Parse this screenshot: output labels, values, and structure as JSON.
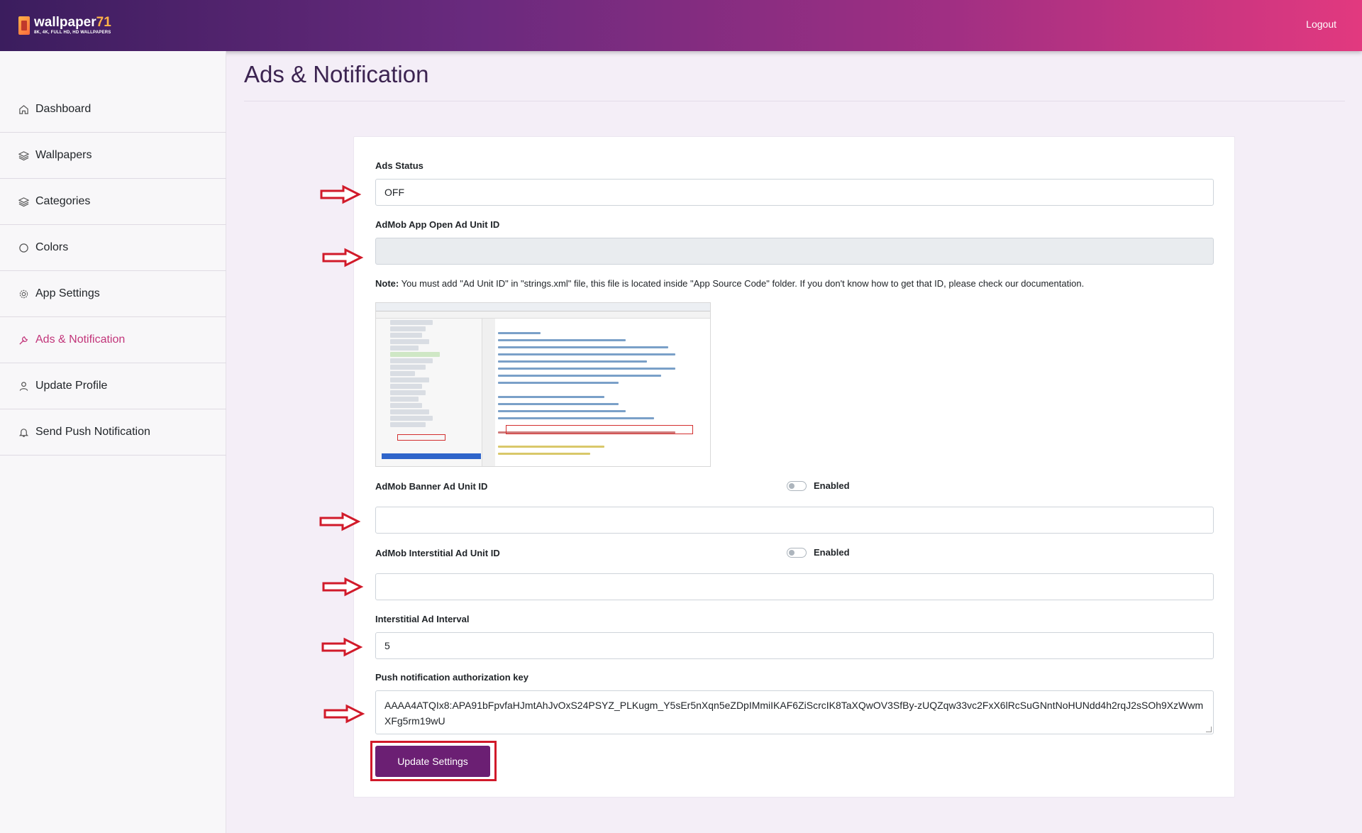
{
  "header": {
    "logo_name": "wallpaper",
    "logo_accent": "71",
    "logo_sub": "8K, 4K, FULL HD, HD WALLPAPERS",
    "logout_label": "Logout"
  },
  "sidebar": {
    "items": [
      {
        "label": "Dashboard",
        "icon": "home-icon"
      },
      {
        "label": "Wallpapers",
        "icon": "layers-icon"
      },
      {
        "label": "Categories",
        "icon": "layers-icon"
      },
      {
        "label": "Colors",
        "icon": "circle-icon"
      },
      {
        "label": "App Settings",
        "icon": "gear-icon"
      },
      {
        "label": "Ads & Notification",
        "icon": "wrench-icon",
        "active": true
      },
      {
        "label": "Update Profile",
        "icon": "user-icon"
      },
      {
        "label": "Send Push Notification",
        "icon": "bell-icon"
      }
    ]
  },
  "page": {
    "title": "Ads & Notification"
  },
  "form": {
    "ads_status_label": "Ads Status",
    "ads_status_value": "OFF",
    "open_ad_label": "AdMob App Open Ad Unit ID",
    "open_ad_value": "",
    "note_prefix": "Note:",
    "note_text": " You must add \"Ad Unit ID\" in \"strings.xml\" file, this file is located inside \"App Source Code\" folder. If you don't know how to get that ID, please check our documentation.",
    "banner_label": "AdMob Banner Ad Unit ID",
    "banner_toggle_label": "Enabled",
    "banner_value": "",
    "interstitial_label": "AdMob Interstitial Ad Unit ID",
    "interstitial_toggle_label": "Enabled",
    "interstitial_value": "",
    "interval_label": "Interstitial Ad Interval",
    "interval_value": "5",
    "push_key_label": "Push notification authorization key",
    "push_key_value": "AAAA4ATQIx8:APA91bFpvfaHJmtAhJvOxS24PSYZ_PLKugm_Y5sEr5nXqn5eZDpIMmiIKAF6ZiScrcIK8TaXQwOV3SfBy-zUQZqw33vc2FxX6lRcSuGNntNoHUNdd4h2rqJ2sSOh9XzWwmXFg5rm19wU",
    "submit_label": "Update Settings"
  },
  "colors": {
    "accent": "#c2357a",
    "button": "#6b1f73",
    "annotation_red": "#d11a2a"
  }
}
